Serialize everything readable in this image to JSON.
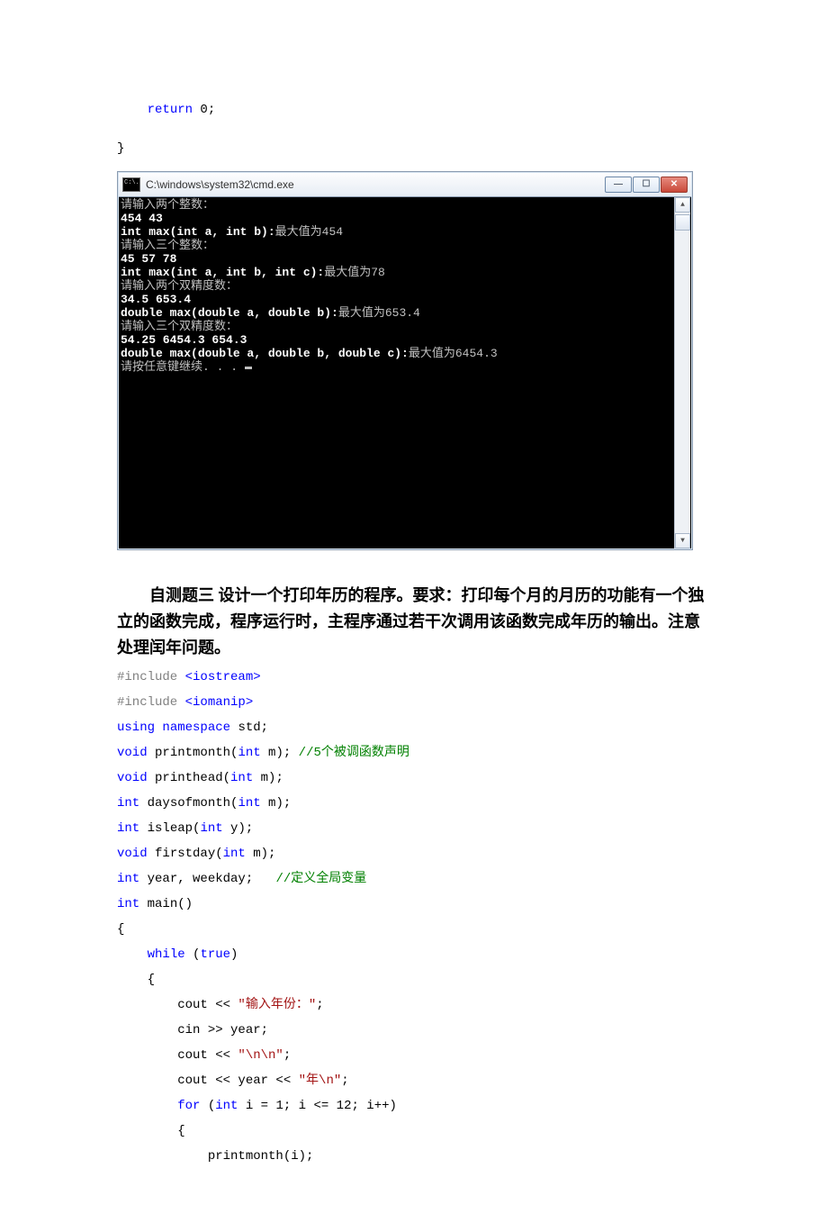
{
  "code_top": {
    "return_kw": "return",
    "zero": " 0;",
    "close_brace": "}"
  },
  "terminal": {
    "title": "C:\\windows\\system32\\cmd.exe",
    "lines": [
      {
        "t": "请输入两个整数：",
        "bold": false
      },
      {
        "t": "454 43",
        "bold": true
      },
      {
        "t": "int max(int a, int b):最大值为454",
        "bold": true,
        "mixed": {
          "prefix": "int max(int a, int b):",
          "suffix": "最大值为454"
        }
      },
      {
        "t": "请输入三个整数：",
        "bold": false
      },
      {
        "t": "45 57 78",
        "bold": true
      },
      {
        "t": "int max(int a, int b, int c):最大值为78",
        "bold": true,
        "mixed": {
          "prefix": "int max(int a, int b, int c):",
          "suffix": "最大值为78"
        }
      },
      {
        "t": "请输入两个双精度数：",
        "bold": false
      },
      {
        "t": "34.5 653.4",
        "bold": true
      },
      {
        "t": "double max(double a, double b):最大值为653.4",
        "bold": true,
        "mixed": {
          "prefix": "double max(double a, double b):",
          "suffix": "最大值为653.4"
        }
      },
      {
        "t": "请输入三个双精度数：",
        "bold": false
      },
      {
        "t": "54.25 6454.3 654.3",
        "bold": true
      },
      {
        "t": "double max(double a, double b, double c):最大值为6454.3",
        "bold": true,
        "mixed": {
          "prefix": "double max(double a, double b, double c):",
          "suffix": "最大值为6454.3"
        }
      },
      {
        "t": "请按任意键继续. . . ",
        "bold": false,
        "cursor": true
      }
    ]
  },
  "problem": {
    "text": "　　自测题三 设计一个打印年历的程序。要求：打印每个月的月历的功能有一个独立的函数完成，程序运行时，主程序通过若干次调用该函数完成年历的输出。注意处理闰年问题。"
  },
  "code2": [
    {
      "parts": [
        {
          "txt": "#include ",
          "cls": "c-pre"
        },
        {
          "txt": "<iostream>",
          "cls": "c-hdr"
        }
      ]
    },
    {
      "parts": [
        {
          "txt": "#include ",
          "cls": "c-pre"
        },
        {
          "txt": "<iomanip>",
          "cls": "c-hdr"
        }
      ]
    },
    {
      "parts": [
        {
          "txt": "using",
          "cls": "c-kw"
        },
        {
          "txt": " ",
          "cls": ""
        },
        {
          "txt": "namespace",
          "cls": "c-kw"
        },
        {
          "txt": " std;",
          "cls": ""
        }
      ]
    },
    {
      "parts": [
        {
          "txt": "void",
          "cls": "c-type"
        },
        {
          "txt": " printmonth(",
          "cls": ""
        },
        {
          "txt": "int",
          "cls": "c-type"
        },
        {
          "txt": " m); ",
          "cls": ""
        },
        {
          "txt": "//5个被调函数声明",
          "cls": "c-cmt"
        }
      ]
    },
    {
      "parts": [
        {
          "txt": "void",
          "cls": "c-type"
        },
        {
          "txt": " printhead(",
          "cls": ""
        },
        {
          "txt": "int",
          "cls": "c-type"
        },
        {
          "txt": " m);",
          "cls": ""
        }
      ]
    },
    {
      "parts": [
        {
          "txt": "int",
          "cls": "c-type"
        },
        {
          "txt": " daysofmonth(",
          "cls": ""
        },
        {
          "txt": "int",
          "cls": "c-type"
        },
        {
          "txt": " m);",
          "cls": ""
        }
      ]
    },
    {
      "parts": [
        {
          "txt": "int",
          "cls": "c-type"
        },
        {
          "txt": " isleap(",
          "cls": ""
        },
        {
          "txt": "int",
          "cls": "c-type"
        },
        {
          "txt": " y);",
          "cls": ""
        }
      ]
    },
    {
      "parts": [
        {
          "txt": "void",
          "cls": "c-type"
        },
        {
          "txt": " firstday(",
          "cls": ""
        },
        {
          "txt": "int",
          "cls": "c-type"
        },
        {
          "txt": " m);",
          "cls": ""
        }
      ]
    },
    {
      "parts": [
        {
          "txt": "int",
          "cls": "c-type"
        },
        {
          "txt": " year, weekday;   ",
          "cls": ""
        },
        {
          "txt": "//定义全局变量",
          "cls": "c-cmt"
        }
      ]
    },
    {
      "parts": [
        {
          "txt": "int",
          "cls": "c-type"
        },
        {
          "txt": " main()",
          "cls": ""
        }
      ]
    },
    {
      "parts": [
        {
          "txt": "{",
          "cls": ""
        }
      ]
    },
    {
      "parts": [
        {
          "txt": "    ",
          "cls": ""
        },
        {
          "txt": "while",
          "cls": "c-kw"
        },
        {
          "txt": " (",
          "cls": ""
        },
        {
          "txt": "true",
          "cls": "c-kw"
        },
        {
          "txt": ")",
          "cls": ""
        }
      ]
    },
    {
      "parts": [
        {
          "txt": "    {",
          "cls": ""
        }
      ]
    },
    {
      "parts": [
        {
          "txt": "        cout << ",
          "cls": ""
        },
        {
          "txt": "\"输入年份：\"",
          "cls": "c-str"
        },
        {
          "txt": ";",
          "cls": ""
        }
      ]
    },
    {
      "parts": [
        {
          "txt": "        cin >> year;",
          "cls": ""
        }
      ]
    },
    {
      "parts": [
        {
          "txt": "        cout << ",
          "cls": ""
        },
        {
          "txt": "\"\\n\\n\"",
          "cls": "c-str"
        },
        {
          "txt": ";",
          "cls": ""
        }
      ]
    },
    {
      "parts": [
        {
          "txt": "        cout << year << ",
          "cls": ""
        },
        {
          "txt": "\"年\\n\"",
          "cls": "c-str"
        },
        {
          "txt": ";",
          "cls": ""
        }
      ]
    },
    {
      "parts": [
        {
          "txt": "        ",
          "cls": ""
        },
        {
          "txt": "for",
          "cls": "c-kw"
        },
        {
          "txt": " (",
          "cls": ""
        },
        {
          "txt": "int",
          "cls": "c-type"
        },
        {
          "txt": " i = 1; i <= 12; i++)",
          "cls": ""
        }
      ]
    },
    {
      "parts": [
        {
          "txt": "        {",
          "cls": ""
        }
      ]
    },
    {
      "parts": [
        {
          "txt": "            printmonth(i);",
          "cls": ""
        }
      ]
    }
  ]
}
